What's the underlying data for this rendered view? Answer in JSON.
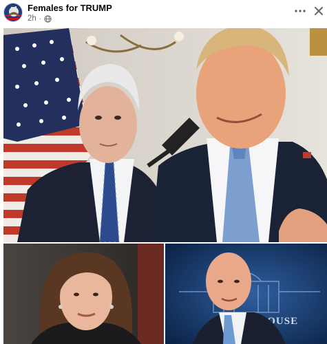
{
  "post": {
    "author": "Females for TRUMP",
    "time": "2h",
    "separator": "·",
    "audience_icon": "globe-icon",
    "more_icon": "more-horizontal-icon",
    "close_icon": "close-icon"
  },
  "photos": {
    "main": {
      "caption": ""
    },
    "left": {
      "caption": ""
    },
    "right": {
      "backdrop_text": "ITE HOUSE"
    }
  }
}
